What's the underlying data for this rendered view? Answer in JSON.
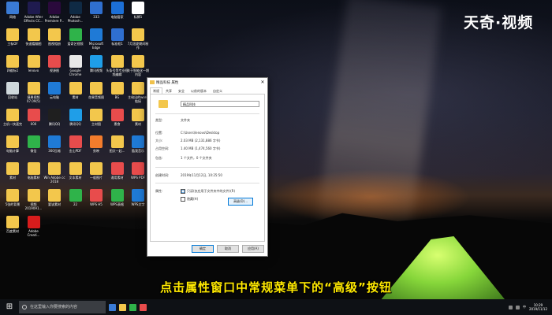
{
  "brand": "天奇·视频",
  "subtitle": "点击属性窗口中常规菜单下的“高级”按钮",
  "desktop": {
    "icons": [
      {
        "label": "网络",
        "color": "#3a7bd5"
      },
      {
        "label": "Adobe After Effects CC...",
        "color": "#1f1b4f"
      },
      {
        "label": "Adobe Premiere P...",
        "color": "#2a0a3c"
      },
      {
        "label": "Adobe Photosh...",
        "color": "#0f2a44"
      },
      {
        "label": "333",
        "color": "#2f6fd0"
      },
      {
        "label": "电脑管家",
        "color": "#1c6fd6"
      },
      {
        "label": "标牌1",
        "color": "#ffffff"
      },
      {
        "label": "王标OF",
        "color": "#f3c74c"
      },
      {
        "label": "快速看翻图",
        "color": "#f3c74c"
      },
      {
        "label": "图视相册",
        "color": "#f3c74c"
      },
      {
        "label": "爱奇艺视频",
        "color": "#2fb34a"
      },
      {
        "label": "Microsoft Edge",
        "color": "#1f7ad6"
      },
      {
        "label": "标准框1",
        "color": "#2f6fd0"
      },
      {
        "label": "7月渲夏期间制作",
        "color": "#f3c74c"
      },
      {
        "label": "四维标1",
        "color": "#f3c74c"
      },
      {
        "label": "lenovo",
        "color": "#f3c74c"
      },
      {
        "label": "视源图",
        "color": "#e84c4c"
      },
      {
        "label": "Google Chrome",
        "color": "#e8e8e8"
      },
      {
        "label": "腾讯视频",
        "color": "#1f9ee8"
      },
      {
        "label": "头条号等专业视频编辑",
        "color": "#f3c74c"
      },
      {
        "label": "关于智能化一期内容",
        "color": "#f3c74c"
      },
      {
        "label": "回收站",
        "color": "#cfd8dc"
      },
      {
        "label": "捷果视频07.09(5)",
        "color": "#f3c74c"
      },
      {
        "label": "云电脑",
        "color": "#1f7ad6"
      },
      {
        "label": "素材",
        "color": "#f3c74c"
      },
      {
        "label": "花果音频图",
        "color": "#f3c74c"
      },
      {
        "label": "BG",
        "color": "#f3c74c"
      },
      {
        "label": "主给出的word链接",
        "color": "#f3c74c"
      },
      {
        "label": "主机一快速完",
        "color": "#f3c74c"
      },
      {
        "label": "000",
        "color": "#e84c4c"
      },
      {
        "label": "腾讯QQ",
        "color": "#1f1f1f"
      },
      {
        "label": "腾讯QQ",
        "color": "#1f9ee8"
      },
      {
        "label": "主材图",
        "color": "#f3c74c"
      },
      {
        "label": "素食",
        "color": "#e84c4c"
      },
      {
        "label": "素材",
        "color": "#f3c74c"
      },
      {
        "label": "电脑计算",
        "color": "#f3c74c"
      },
      {
        "label": "微信",
        "color": "#2fb34a"
      },
      {
        "label": "360压缩",
        "color": "#1f7ad6"
      },
      {
        "label": "金山PDF",
        "color": "#e84c4c"
      },
      {
        "label": "剪映",
        "color": "#f37c2c"
      },
      {
        "label": "图文一起...",
        "color": "#f3c74c"
      },
      {
        "label": "酷我音乐",
        "color": "#1f7ad6"
      },
      {
        "label": "素材",
        "color": "#f3c74c"
      },
      {
        "label": "电脑素材",
        "color": "#f3c74c"
      },
      {
        "label": "Win Adobe cc 2018",
        "color": "#f3c74c"
      },
      {
        "label": "文本素材",
        "color": "#f3c74c"
      },
      {
        "label": "一般图片",
        "color": "#f3c74c"
      },
      {
        "label": "通用素材",
        "color": "#e84c4c"
      },
      {
        "label": "WPS PDF",
        "color": "#e84c4c"
      },
      {
        "label": "5张的背景",
        "color": "#f3c74c"
      },
      {
        "label": "视频 2019091...",
        "color": "#f3c74c"
      },
      {
        "label": "要该素材",
        "color": "#f3c74c"
      },
      {
        "label": "22",
        "color": "#2fb34a"
      },
      {
        "label": "WPS H5",
        "color": "#e84c4c"
      },
      {
        "label": "WPS表格",
        "color": "#2fb34a"
      },
      {
        "label": "WPS文字",
        "color": "#1f7ad6"
      },
      {
        "label": "百度素材",
        "color": "#f3c74c"
      },
      {
        "label": "Adobe Creati...",
        "color": "#d81c1c"
      }
    ]
  },
  "dialog": {
    "title": "精品科技 属性",
    "close_glyph": "✕",
    "tabs": [
      "常规",
      "共享",
      "安全",
      "以前的版本",
      "自定义"
    ],
    "folder_name": "精品科技",
    "props": [
      {
        "k": "类型:",
        "v": "文件夹"
      },
      {
        "k": "位置:",
        "v": "C:\\Users\\lenovo\\Desktop"
      },
      {
        "k": "大小:",
        "v": "2.03 MB (2,131,886 字节)"
      },
      {
        "k": "占用空间:",
        "v": "1.40 MB (1,474,560 字节)"
      },
      {
        "k": "包含:",
        "v": "1 个文件，0 个文件夹"
      },
      {
        "k": "创建时间:",
        "v": "2019年11月12日, 10:25:50"
      },
      {
        "k": "属性:",
        "v": ""
      }
    ],
    "readonly_label": "只读(仅应用于文件夹中的文件)(R)",
    "hidden_label": "隐藏(H)",
    "advanced_label": "高级(D)...",
    "ok_label": "确定",
    "cancel_label": "取消",
    "apply_label": "应用(A)"
  },
  "taskbar": {
    "start_glyph": "⊞",
    "search_placeholder": "在这里输入你要搜索的内容",
    "time": "10:29",
    "date": "2019/11/12",
    "lang": "中"
  }
}
